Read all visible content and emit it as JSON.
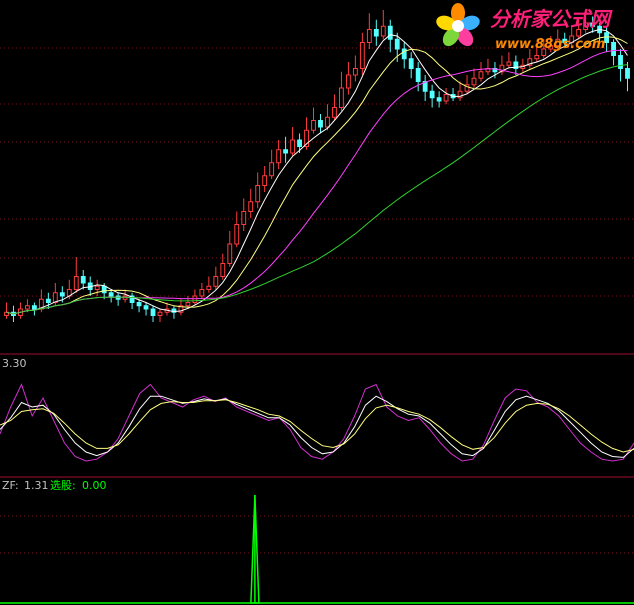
{
  "watermark": {
    "brand": "分析家公式网",
    "url": "www.88gs.com"
  },
  "panels": {
    "main": {
      "name": "price"
    },
    "oscillator": {
      "value_label": "3.30"
    },
    "indicator": {
      "zf_label": "ZF:",
      "zf_value": "1.31",
      "xg_label": "选股:",
      "xg_value": "0.00"
    }
  },
  "colors": {
    "up": "#ff3c3c",
    "down": "#54ffff",
    "ma_fast": "#ffffff",
    "ma_mid": "#ffff80",
    "ma_slow": "#ff40ff",
    "ma_long": "#30d030",
    "divider": "#a01030",
    "grid": "#7a1020",
    "signal": "#00ff00",
    "osc_purple": "#d030d0"
  },
  "chart_data": [
    {
      "type": "candlestick",
      "title": "",
      "ylim": [
        0,
        100
      ],
      "candles": [
        [
          28,
          29,
          32,
          27
        ],
        [
          29,
          28,
          31,
          26
        ],
        [
          28,
          30,
          32,
          27
        ],
        [
          30,
          31,
          33,
          29
        ],
        [
          31,
          30,
          32,
          28
        ],
        [
          30,
          33,
          36,
          29
        ],
        [
          33,
          32,
          35,
          30
        ],
        [
          32,
          35,
          38,
          31
        ],
        [
          35,
          34,
          37,
          32
        ],
        [
          34,
          36,
          39,
          33
        ],
        [
          36,
          40,
          46,
          35
        ],
        [
          40,
          38,
          42,
          36
        ],
        [
          38,
          36,
          40,
          34
        ],
        [
          36,
          37,
          39,
          34
        ],
        [
          37,
          35,
          38,
          33
        ],
        [
          35,
          34,
          36,
          32
        ],
        [
          34,
          33,
          35,
          31
        ],
        [
          33,
          34,
          36,
          32
        ],
        [
          34,
          32,
          35,
          30
        ],
        [
          32,
          31,
          33,
          29
        ],
        [
          31,
          30,
          32,
          28
        ],
        [
          30,
          28,
          31,
          26
        ],
        [
          28,
          29,
          30,
          26
        ],
        [
          29,
          30,
          32,
          28
        ],
        [
          30,
          29,
          31,
          27
        ],
        [
          29,
          31,
          33,
          28
        ],
        [
          31,
          32,
          34,
          30
        ],
        [
          32,
          34,
          36,
          31
        ],
        [
          34,
          36,
          38,
          33
        ],
        [
          36,
          37,
          40,
          35
        ],
        [
          37,
          40,
          43,
          36
        ],
        [
          40,
          44,
          47,
          39
        ],
        [
          44,
          50,
          54,
          43
        ],
        [
          50,
          56,
          60,
          49
        ],
        [
          56,
          60,
          64,
          54
        ],
        [
          60,
          63,
          67,
          58
        ],
        [
          63,
          68,
          72,
          61
        ],
        [
          68,
          71,
          74,
          66
        ],
        [
          71,
          75,
          79,
          70
        ],
        [
          75,
          79,
          82,
          73
        ],
        [
          79,
          78,
          83,
          75
        ],
        [
          78,
          82,
          86,
          77
        ],
        [
          82,
          80,
          84,
          78
        ],
        [
          80,
          85,
          89,
          79
        ],
        [
          85,
          88,
          92,
          84
        ],
        [
          88,
          86,
          90,
          84
        ],
        [
          86,
          89,
          93,
          85
        ],
        [
          89,
          92,
          96,
          88
        ],
        [
          92,
          98,
          103,
          91
        ],
        [
          98,
          102,
          106,
          96
        ],
        [
          102,
          104,
          108,
          100
        ],
        [
          104,
          112,
          115,
          102
        ],
        [
          112,
          116,
          121,
          110
        ],
        [
          116,
          114,
          119,
          111
        ],
        [
          114,
          117,
          122,
          113
        ],
        [
          117,
          113,
          119,
          109
        ],
        [
          113,
          110,
          115,
          106
        ],
        [
          110,
          107,
          112,
          104
        ],
        [
          107,
          104,
          109,
          101
        ],
        [
          104,
          100,
          106,
          97
        ],
        [
          100,
          97,
          102,
          94
        ],
        [
          97,
          95,
          99,
          92
        ],
        [
          95,
          94,
          97,
          92
        ],
        [
          94,
          96,
          98,
          93
        ],
        [
          96,
          95,
          98,
          94
        ],
        [
          95,
          97,
          100,
          94
        ],
        [
          97,
          99,
          102,
          96
        ],
        [
          99,
          101,
          104,
          98
        ],
        [
          101,
          103,
          106,
          100
        ],
        [
          103,
          104,
          107,
          102
        ],
        [
          104,
          103,
          106,
          101
        ],
        [
          103,
          105,
          108,
          102
        ],
        [
          105,
          106,
          109,
          104
        ],
        [
          106,
          104,
          108,
          102
        ],
        [
          104,
          105,
          107,
          103
        ],
        [
          105,
          107,
          110,
          104
        ],
        [
          107,
          108,
          112,
          106
        ],
        [
          108,
          110,
          113,
          107
        ],
        [
          110,
          111,
          114,
          109
        ],
        [
          111,
          113,
          116,
          110
        ],
        [
          113,
          112,
          115,
          111
        ],
        [
          112,
          114,
          117,
          111
        ],
        [
          114,
          116,
          119,
          113
        ],
        [
          116,
          118,
          120,
          115
        ],
        [
          118,
          117,
          120,
          115
        ],
        [
          117,
          115,
          118,
          112
        ],
        [
          115,
          112,
          117,
          109
        ],
        [
          112,
          108,
          113,
          105
        ],
        [
          108,
          104,
          110,
          100
        ],
        [
          104,
          101,
          106,
          97
        ]
      ],
      "ma": [
        {
          "name": "MA5",
          "color": "#ffffff"
        },
        {
          "name": "MA10",
          "color": "#ffff80"
        },
        {
          "name": "MA20",
          "color": "#ff40ff"
        },
        {
          "name": "MA60",
          "color": "#30d030"
        }
      ]
    },
    {
      "type": "line",
      "title": "",
      "ylim": [
        0,
        100
      ],
      "series": [
        {
          "values": [
            40,
            70,
            95,
            60,
            80,
            55,
            30,
            15,
            10,
            12,
            20,
            35,
            60,
            85,
            95,
            80,
            75,
            70,
            78,
            82,
            76,
            80,
            70,
            65,
            60,
            55,
            58,
            45,
            25,
            15,
            12,
            20,
            35,
            60,
            90,
            95,
            70,
            60,
            55,
            58,
            45,
            30,
            18,
            10,
            12,
            28,
            55,
            80,
            90,
            88,
            75,
            70,
            60,
            45,
            30,
            20,
            12,
            10,
            12,
            30
          ]
        },
        {
          "values": [
            45,
            58,
            75,
            70,
            72,
            62,
            45,
            30,
            20,
            16,
            20,
            30,
            48,
            68,
            82,
            82,
            78,
            74,
            76,
            79,
            77,
            79,
            73,
            68,
            63,
            58,
            58,
            50,
            36,
            25,
            18,
            20,
            30,
            48,
            72,
            82,
            76,
            68,
            62,
            60,
            52,
            40,
            28,
            18,
            16,
            24,
            44,
            65,
            78,
            82,
            78,
            74,
            66,
            54,
            42,
            30,
            20,
            15,
            14,
            24
          ]
        },
        {
          "values": [
            50,
            55,
            65,
            67,
            68,
            63,
            52,
            40,
            30,
            24,
            24,
            28,
            40,
            54,
            67,
            74,
            76,
            75,
            75,
            77,
            77,
            78,
            75,
            71,
            67,
            62,
            60,
            54,
            44,
            35,
            27,
            25,
            29,
            40,
            57,
            69,
            72,
            69,
            65,
            62,
            56,
            47,
            37,
            28,
            23,
            25,
            36,
            52,
            65,
            72,
            74,
            73,
            68,
            60,
            50,
            40,
            31,
            24,
            20,
            23
          ]
        }
      ]
    },
    {
      "type": "bar",
      "title": "",
      "ylim": [
        0,
        1.31
      ],
      "values": [
        0,
        0,
        0,
        0,
        0,
        0,
        0,
        0,
        0,
        0,
        0,
        0,
        0,
        0,
        0,
        0,
        0,
        0,
        0,
        0,
        0,
        0,
        0,
        0,
        0,
        0,
        0,
        0,
        0,
        0,
        0,
        0,
        0,
        0,
        0,
        0,
        1.31,
        0,
        0,
        0,
        0,
        0,
        0,
        0,
        0,
        0,
        0,
        0,
        0,
        0,
        0,
        0,
        0,
        0,
        0,
        0,
        0,
        0,
        0,
        0,
        0,
        0,
        0,
        0,
        0,
        0,
        0,
        0,
        0,
        0,
        0,
        0,
        0,
        0,
        0,
        0,
        0,
        0,
        0,
        0,
        0,
        0,
        0,
        0,
        0,
        0,
        0,
        0,
        0,
        0,
        0
      ]
    }
  ]
}
